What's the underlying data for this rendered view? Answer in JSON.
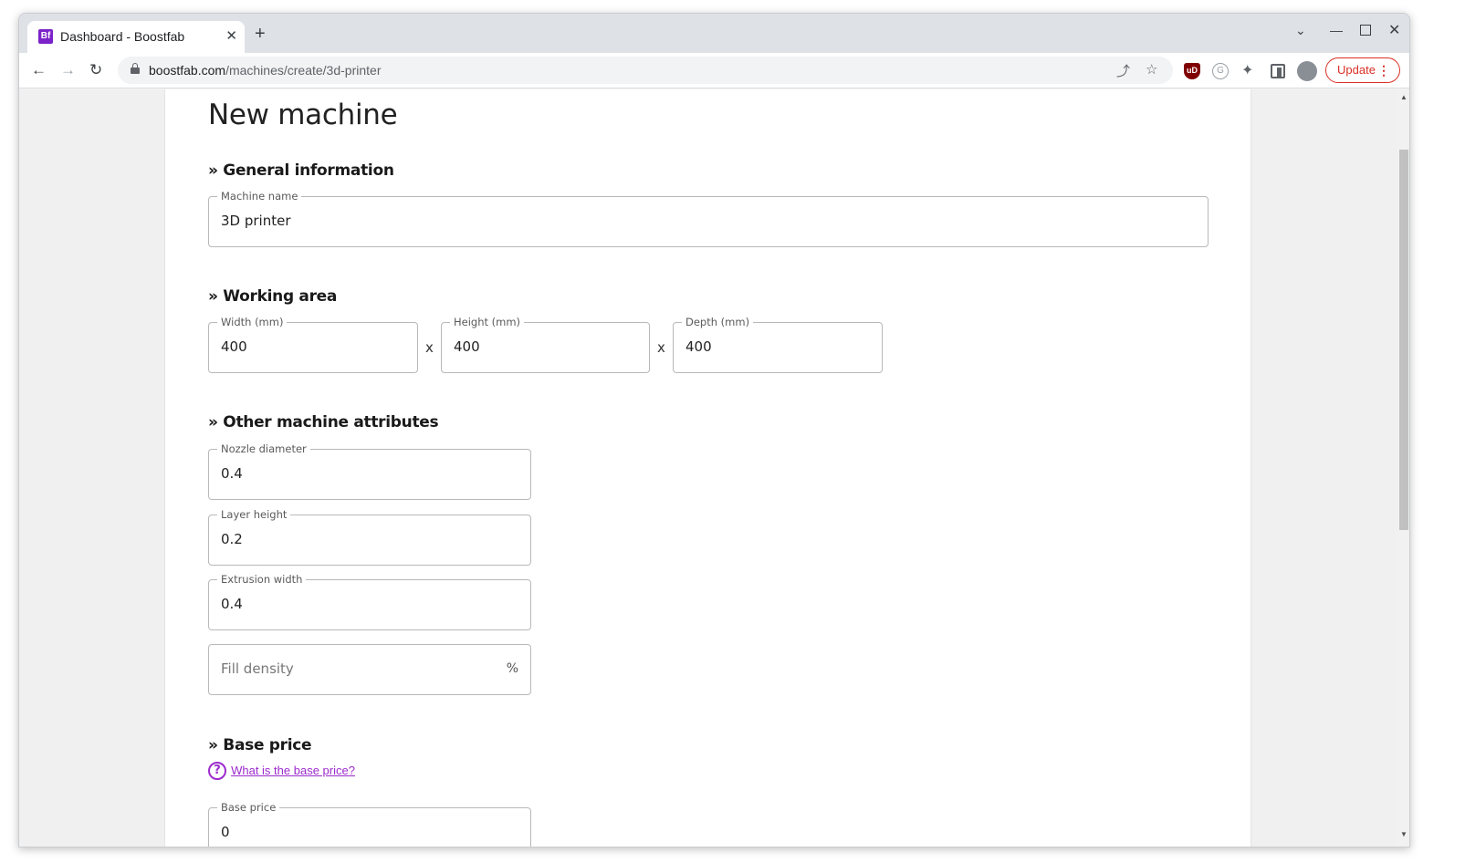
{
  "browser": {
    "tab_title": "Dashboard - Boostfab",
    "tab_favicon_text": "Bf",
    "url_host": "boostfab.com",
    "url_path": "/machines/create/3d-printer",
    "update_label": "Update"
  },
  "page": {
    "title": "New machine",
    "sections": {
      "general": "» General information",
      "working_area": "» Working area",
      "other": "» Other machine attributes",
      "base_price": "» Base price"
    },
    "fields": {
      "machine_name": {
        "label": "Machine name",
        "value": "3D printer"
      },
      "width": {
        "label": "Width (mm)",
        "value": "400"
      },
      "height": {
        "label": "Height (mm)",
        "value": "400"
      },
      "depth": {
        "label": "Depth (mm)",
        "value": "400"
      },
      "nozzle": {
        "label": "Nozzle diameter",
        "value": "0.4"
      },
      "layer_height": {
        "label": "Layer height",
        "value": "0.2"
      },
      "extrusion_width": {
        "label": "Extrusion width",
        "value": "0.4"
      },
      "fill_density": {
        "placeholder": "Fill density",
        "suffix": "%"
      },
      "base_price": {
        "label": "Base price",
        "value": "0"
      }
    },
    "dimension_separator": "x",
    "help_link": "What is the base price?",
    "help_icon_glyph": "?"
  },
  "colors": {
    "accent": "#9c2bcd",
    "favicon": "#7b22c9",
    "update": "#d93025"
  }
}
